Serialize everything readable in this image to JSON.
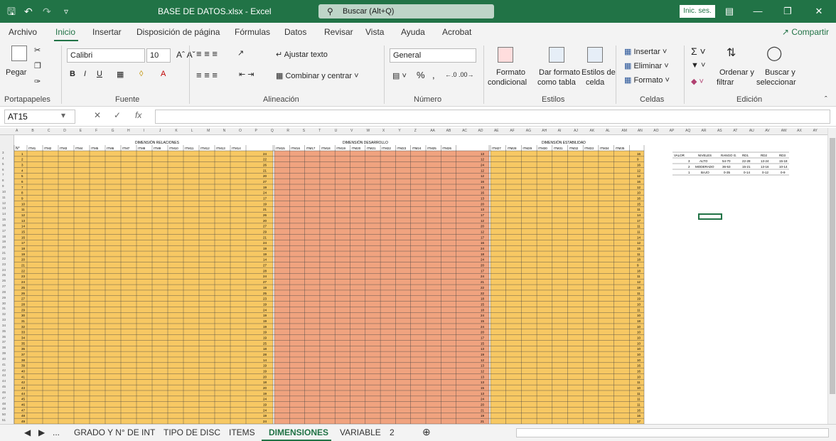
{
  "titlebar": {
    "filename": "BASE DE DATOS.xlsx  -  Excel",
    "search_placeholder": "Buscar (Alt+Q)",
    "signin": "Inic. ses."
  },
  "menu": {
    "items": [
      "Archivo",
      "Inicio",
      "Insertar",
      "Disposición de página",
      "Fórmulas",
      "Datos",
      "Revisar",
      "Vista",
      "Ayuda",
      "Acrobat"
    ],
    "share": "Compartir"
  },
  "ribbon": {
    "paste": "Pegar",
    "font_name": "Calibri",
    "font_size": "10",
    "wrap_text": "Ajustar texto",
    "merge_center": "Combinar y centrar",
    "number_format": "General",
    "conditional_format": [
      "Formato",
      "condicional"
    ],
    "format_table": [
      "Dar formato",
      "como tabla"
    ],
    "cell_styles": [
      "Estilos de",
      "celda"
    ],
    "insert": "Insertar",
    "delete": "Eliminar",
    "format": "Formato",
    "sort_filter": [
      "Ordenar y",
      "filtrar"
    ],
    "find_select": [
      "Buscar y",
      "seleccionar"
    ],
    "groups": [
      "Portapapeles",
      "Fuente",
      "Alineación",
      "Número",
      "Estilos",
      "Celdas",
      "Edición"
    ]
  },
  "formula_bar": {
    "name_box": "AT15",
    "fx": "fx"
  },
  "sheet": {
    "column_letters": [
      "A",
      "B",
      "C",
      "D",
      "E",
      "F",
      "G",
      "H",
      "I",
      "J",
      "K",
      "L",
      "M",
      "N",
      "O",
      "P",
      "Q",
      "R",
      "S",
      "T",
      "U",
      "V",
      "W",
      "X",
      "Y",
      "Z",
      "AA",
      "AB",
      "AC",
      "AD",
      "AE",
      "AF",
      "AG",
      "AH",
      "AI",
      "AJ",
      "AK",
      "AL",
      "AM",
      "AN",
      "AO",
      "AP",
      "AQ",
      "AR",
      "AS",
      "AT",
      "AU",
      "AV",
      "AW",
      "AX",
      "AY"
    ],
    "section_titles": [
      "DIMENSIÓN RELACIONES",
      "DIMENSIÓN DESARROLLO",
      "DIMENSIÓN ESTABILIDAD"
    ],
    "header_n": "N°",
    "relaciones_items": [
      "ITM1",
      "ITM2",
      "ITM3",
      "ITM4",
      "ITM5",
      "ITM6",
      "ITM7",
      "ITM8",
      "ITM9",
      "ITM10",
      "ITM11",
      "ITM12",
      "ITM13",
      "ITM14"
    ],
    "desarrollo_items": [
      "ITM15",
      "ITM16",
      "ITM17",
      "ITM18",
      "ITM19",
      "ITM20",
      "ITM21",
      "ITM22",
      "ITM23",
      "ITM24",
      "ITM25",
      "ITM26"
    ],
    "estabilidad_items": [
      "ITM27",
      "ITM28",
      "ITM29",
      "ITM30",
      "ITM31",
      "ITM32",
      "ITM33",
      "ITM34",
      "ITM35"
    ],
    "relaciones_totals": [
      24,
      22,
      26,
      21,
      20,
      27,
      19,
      24,
      17,
      19,
      21,
      26,
      20,
      27,
      29,
      21,
      24,
      19,
      19,
      14,
      27,
      28,
      24,
      27,
      19,
      25,
      23,
      19,
      24,
      19,
      19,
      19,
      19,
      19,
      25,
      18,
      28,
      14,
      19,
      19,
      20,
      18,
      20,
      19,
      24,
      19,
      24,
      19,
      24
    ],
    "desarrollo_totals": [
      13,
      12,
      24,
      12,
      12,
      16,
      13,
      16,
      13,
      20,
      13,
      17,
      12,
      20,
      12,
      17,
      16,
      24,
      18,
      24,
      20,
      17,
      24,
      21,
      22,
      22,
      18,
      15,
      18,
      24,
      15,
      24,
      20,
      17,
      15,
      13,
      19,
      12,
      13,
      12,
      13,
      13,
      15,
      13,
      24,
      20,
      21,
      19,
      21
    ],
    "estabilidad_totals": [
      16,
      9,
      16,
      12,
      12,
      16,
      12,
      10,
      16,
      15,
      11,
      14,
      17,
      11,
      11,
      14,
      12,
      15,
      11,
      18,
      9,
      18,
      11,
      12,
      18,
      11,
      19,
      10,
      11,
      10,
      18,
      10,
      10,
      10,
      10,
      10,
      10,
      10,
      16,
      16,
      10,
      11,
      10,
      11,
      11,
      11,
      16,
      16,
      17
    ],
    "lookup_table": {
      "headers": [
        "VALOR",
        "NIVELES",
        "RANGO G.",
        "RD1",
        "RD2",
        "RD3"
      ],
      "rows": [
        [
          "3",
          "ALTO",
          "54-70",
          "22-28",
          "13-24",
          "15-18"
        ],
        [
          "2",
          "MODERADO",
          "36-53",
          "15-21",
          "13-16",
          "10-14"
        ],
        [
          "1",
          "BAJO",
          "0-35",
          "0-14",
          "0-12",
          "0-9"
        ]
      ]
    }
  },
  "tabs": {
    "items": [
      "GRADO Y N° DE INT",
      "TIPO DE DISC",
      "ITEMS",
      "DIMENSIONES",
      "VARIABLE",
      "2"
    ],
    "active": "DIMENSIONES",
    "more": "..."
  },
  "colors": {
    "excel_green": "#217346",
    "yellow_band": "#f7c863",
    "salmon_band": "#f0a37f",
    "selection": "#217346"
  }
}
